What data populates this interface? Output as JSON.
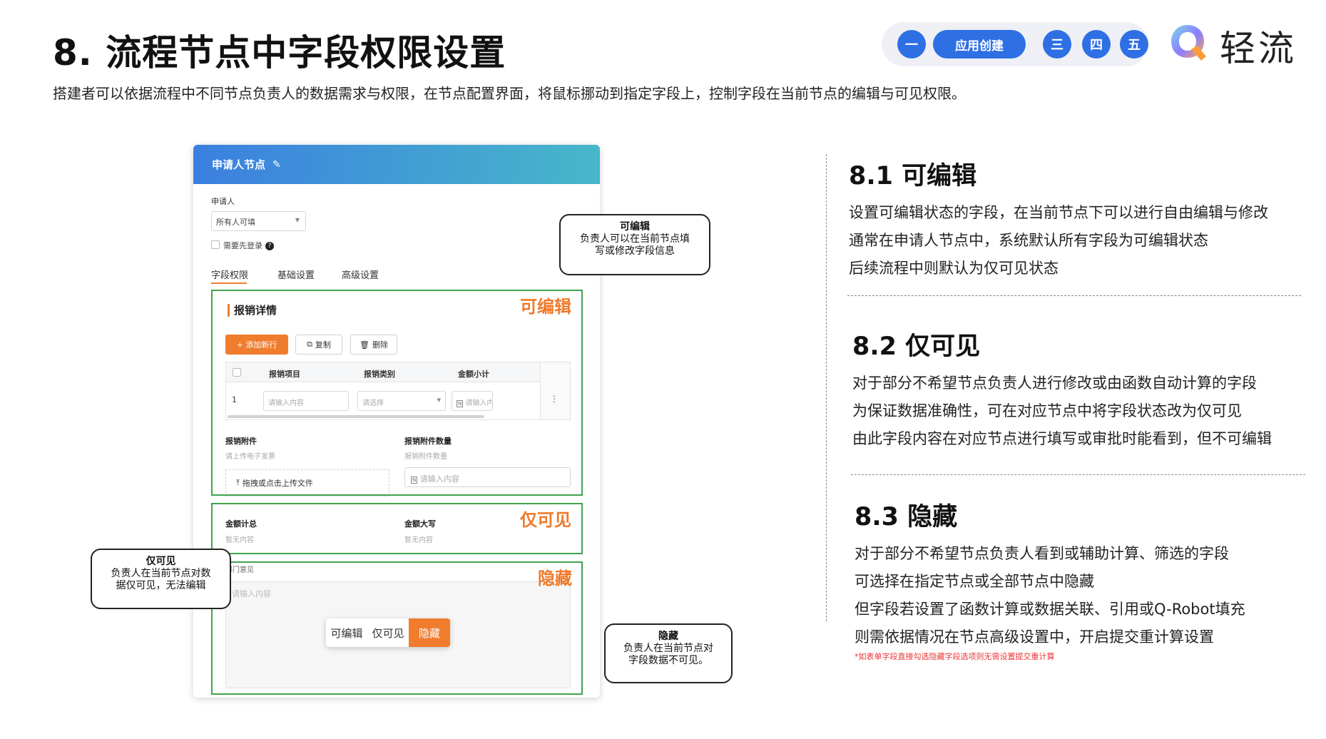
{
  "header": {
    "title": "8. 流程节点中字段权限设置",
    "subtitle": "搭建者可以依据流程中不同节点负责人的数据需求与权限，在节点配置界面，将鼠标挪动到指定字段上，控制字段在当前节点的编辑与可见权限。"
  },
  "nav": {
    "items": [
      "一",
      "应用创建",
      "三",
      "四",
      "五"
    ],
    "active_index": 1,
    "accent": "#2f6fe4"
  },
  "logo": {
    "text": "轻流"
  },
  "form": {
    "node_title": "申请人节点",
    "applicant_label": "申请人",
    "applicant_select": "所有人可填",
    "login_required": "需要先登录",
    "tabs": [
      "字段权限",
      "基础设置",
      "高级设置"
    ],
    "section_title": "报销详情",
    "buttons": {
      "add_row": "+ 添加新行",
      "copy": "复制",
      "delete": "删除"
    },
    "table": {
      "headers": [
        "报销项目",
        "报销类别",
        "金额小计"
      ],
      "row_index": "1",
      "placeholders": [
        "请输入内容",
        "请选择",
        "请输入内"
      ]
    },
    "attachment_label": "报销附件",
    "attachment_hint": "请上传电子发票",
    "upload_text": "拖拽或点击上传文件",
    "attachment_count_label": "报销附件数量",
    "attachment_count_hint": "报销附件数量",
    "attachment_count_placeholder": "请输入内容",
    "total_label": "金额计总",
    "total_value": "暂无内容",
    "total_upper_label": "金额大写",
    "total_upper_value": "暂无内容",
    "dept_label": "部门意见",
    "dept_placeholder": "请输入内容",
    "permission_options": [
      "可编辑",
      "仅可见",
      "隐藏"
    ],
    "permission_active": "隐藏"
  },
  "frames": {
    "editable": "可编辑",
    "readonly": "仅可见",
    "hidden": "隐藏"
  },
  "callouts": {
    "editable": {
      "title": "可编辑",
      "lines": [
        "负责人可以在当前节点填",
        "写或修改字段信息"
      ]
    },
    "readonly": {
      "title": "仅可见",
      "lines": [
        "负责人在当前节点对数",
        "据仅可见，无法编辑"
      ]
    },
    "hidden": {
      "title": "隐藏",
      "lines": [
        "负责人在当前节点对",
        "字段数据不可见。"
      ]
    }
  },
  "sections": [
    {
      "heading": "8.1 可编辑",
      "lines": [
        "设置可编辑状态的字段，在当前节点下可以进行自由编辑与修改",
        "通常在申请人节点中，系统默认所有字段为可编辑状态",
        "后续流程中则默认为仅可见状态"
      ]
    },
    {
      "heading": "8.2 仅可见",
      "lines": [
        "对于部分不希望节点负责人进行修改或由函数自动计算的字段",
        "为保证数据准确性，可在对应节点中将字段状态改为仅可见",
        "由此字段内容在对应节点进行填写或审批时能看到，但不可编辑"
      ]
    },
    {
      "heading": "8.3 隐藏",
      "lines": [
        "对于部分不希望节点负责人看到或辅助计算、筛选的字段",
        "可选择在指定节点或全部节点中隐藏",
        "但字段若设置了函数计算或数据关联、引用或Q-Robot填充",
        "则需依据情况在节点高级设置中，开启提交重计算设置"
      ],
      "footnote": "*如表单字段直接勾选隐藏字段选项则无需设置提交重计算"
    }
  ],
  "colors": {
    "orange": "#ef7a2a",
    "green_frame": "#3fa34d",
    "blue": "#2f6fe4"
  }
}
